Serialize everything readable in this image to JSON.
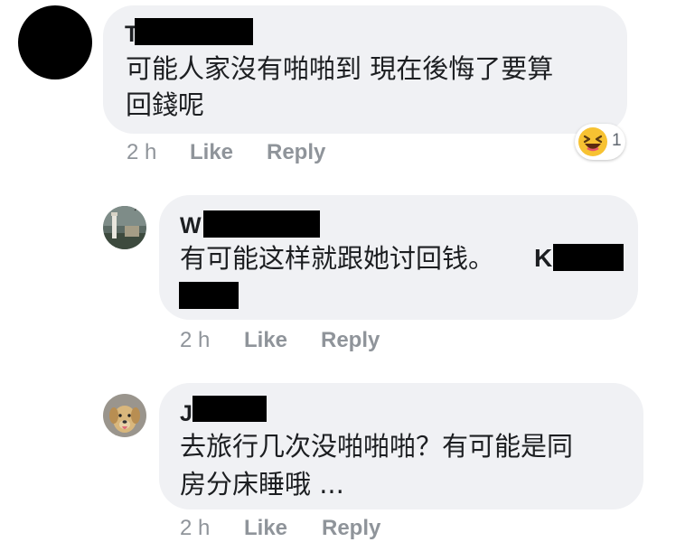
{
  "comments": [
    {
      "author_initial": "T",
      "text_lines": [
        "可能人家沒有啪啪到 現在後悔了要算",
        "回錢呢"
      ],
      "time": "2 h",
      "like_label": "Like",
      "reply_label": "Reply",
      "reaction": {
        "icon": "laughing-emoji-icon",
        "count": "1"
      }
    },
    {
      "author_initial": "W",
      "text_lines": [
        "有可能这样就跟她讨回钱。"
      ],
      "mention_initial": "K",
      "time": "2 h",
      "like_label": "Like",
      "reply_label": "Reply"
    },
    {
      "author_initial": "J",
      "text_lines": [
        "去旅行几次没啪啪啪？有可能是同",
        "房分床睡哦 ..."
      ],
      "time": "2 h",
      "like_label": "Like",
      "reply_label": "Reply"
    }
  ],
  "colors": {
    "bubble": "#f0f1f4",
    "meta": "#8f949a",
    "text": "#1c1e21",
    "redaction": "#000000"
  }
}
